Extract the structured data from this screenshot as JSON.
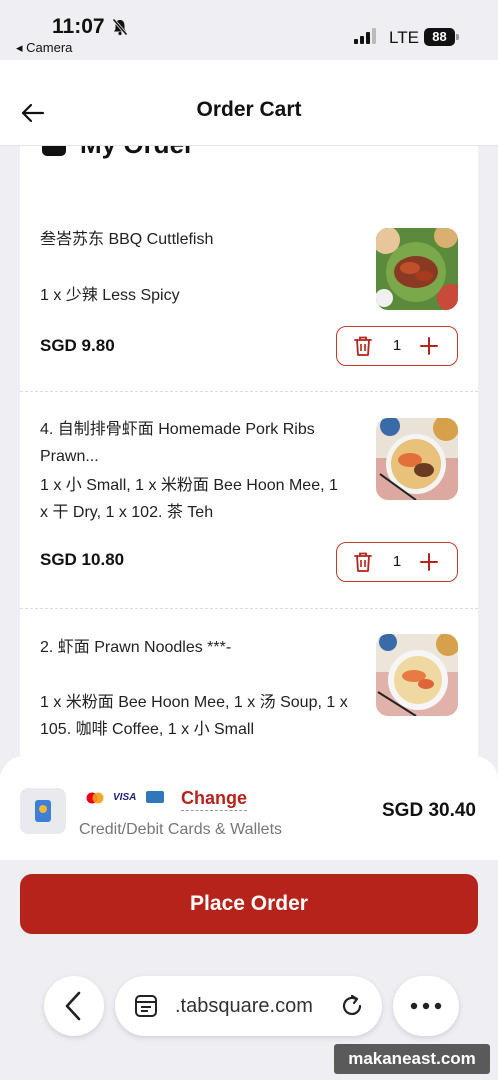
{
  "status_bar": {
    "time": "11:07",
    "back_app": "◂ Camera",
    "network": "LTE",
    "battery": "88"
  },
  "header": {
    "title": "Order Cart"
  },
  "section": {
    "title": "My Order"
  },
  "items": [
    {
      "name": "叁峇苏东 BBQ Cuttlefish",
      "options": "1 x 少辣 Less Spicy",
      "price": "SGD 9.80",
      "quantity": "1"
    },
    {
      "name": "4. 自制排骨虾面 Homemade Pork Ribs Prawn...",
      "options": "1 x 小 Small, 1 x 米粉面 Bee Hoon Mee, 1 x 干 Dry, 1 x 102. 茶 Teh",
      "price": "SGD 10.80",
      "quantity": "1"
    },
    {
      "name": "2. 虾面 Prawn Noodles ***-",
      "options": "1 x 米粉面 Bee Hoon Mee, 1 x 汤 Soup, 1 x 105. 咖啡 Coffee, 1 x 小 Small"
    }
  ],
  "payment": {
    "visa_label": "VISA",
    "change_label": "Change",
    "method_label": "Credit/Debit Cards & Wallets",
    "total": "SGD 30.40"
  },
  "place_order_label": "Place Order",
  "browser": {
    "url": ".tabsquare.com"
  },
  "watermark": "makaneast.com",
  "colors": {
    "accent": "#b5231b",
    "background": "#eeeef3"
  }
}
